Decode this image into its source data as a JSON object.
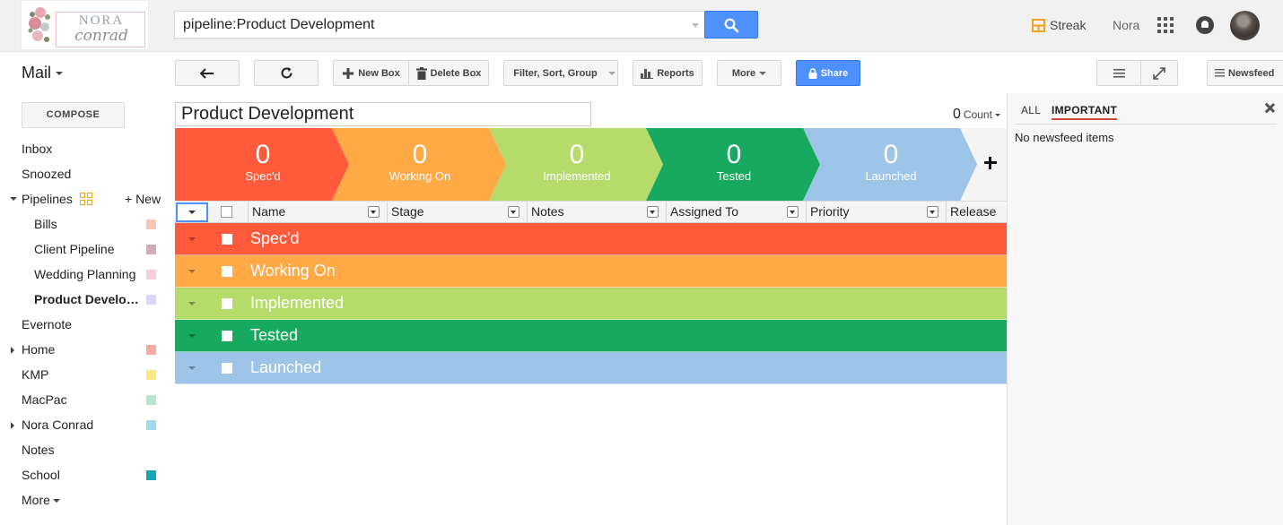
{
  "logo": {
    "line1": "NORA",
    "line2": "conrad"
  },
  "search": {
    "value": "pipeline:Product Development"
  },
  "header": {
    "streak_label": "Streak",
    "user_name": "Nora"
  },
  "colors": {
    "accent": "#4d90fe",
    "streak_orange": "#f4a21d",
    "important_underline": "#d14836"
  },
  "mail": {
    "title": "Mail",
    "compose": "COMPOSE"
  },
  "nav": {
    "inbox": "Inbox",
    "snoozed": "Snoozed",
    "pipelines": "Pipelines",
    "new": "+ New",
    "bills": "Bills",
    "client_pipeline": "Client Pipeline",
    "wedding_planning": "Wedding Planning",
    "product_development": "Product Development",
    "evernote": "Evernote",
    "home": "Home",
    "kmp": "KMP",
    "macpac": "MacPac",
    "nora_conrad": "Nora Conrad",
    "notes": "Notes",
    "school": "School",
    "more": "More"
  },
  "label_colors": {
    "bills": "#fbc5b4",
    "client_pipeline": "#d3a9b6",
    "wedding_planning": "#f8cedc",
    "product_development": "#dcd6fb",
    "home": "#f5aaa2",
    "kmp": "#fbe983",
    "macpac": "#b9e4d0",
    "nora_conrad": "#9fdce8",
    "school": "#16a6b6"
  },
  "toolbar": {
    "new_box": "New Box",
    "delete_box": "Delete Box",
    "filter": "Filter, Sort, Group",
    "reports": "Reports",
    "more": "More",
    "share": "Share",
    "newsfeed": "Newsfeed"
  },
  "pipeline": {
    "name": "Product Development",
    "count_value": "0",
    "count_label": "Count"
  },
  "stages": [
    {
      "count": "0",
      "label": "Spec'd",
      "color": "#ff5a3c"
    },
    {
      "count": "0",
      "label": "Working On",
      "color": "#ffaa46"
    },
    {
      "count": "0",
      "label": "Implemented",
      "color": "#b5dc6a"
    },
    {
      "count": "0",
      "label": "Tested",
      "color": "#18a960"
    },
    {
      "count": "0",
      "label": "Launched",
      "color": "#9ec5e8"
    }
  ],
  "columns": {
    "name": "Name",
    "stage": "Stage",
    "notes": "Notes",
    "assigned_to": "Assigned To",
    "priority": "Priority",
    "release": "Release"
  },
  "newsfeed": {
    "tab_all": "ALL",
    "tab_important": "IMPORTANT",
    "empty": "No newsfeed items"
  }
}
